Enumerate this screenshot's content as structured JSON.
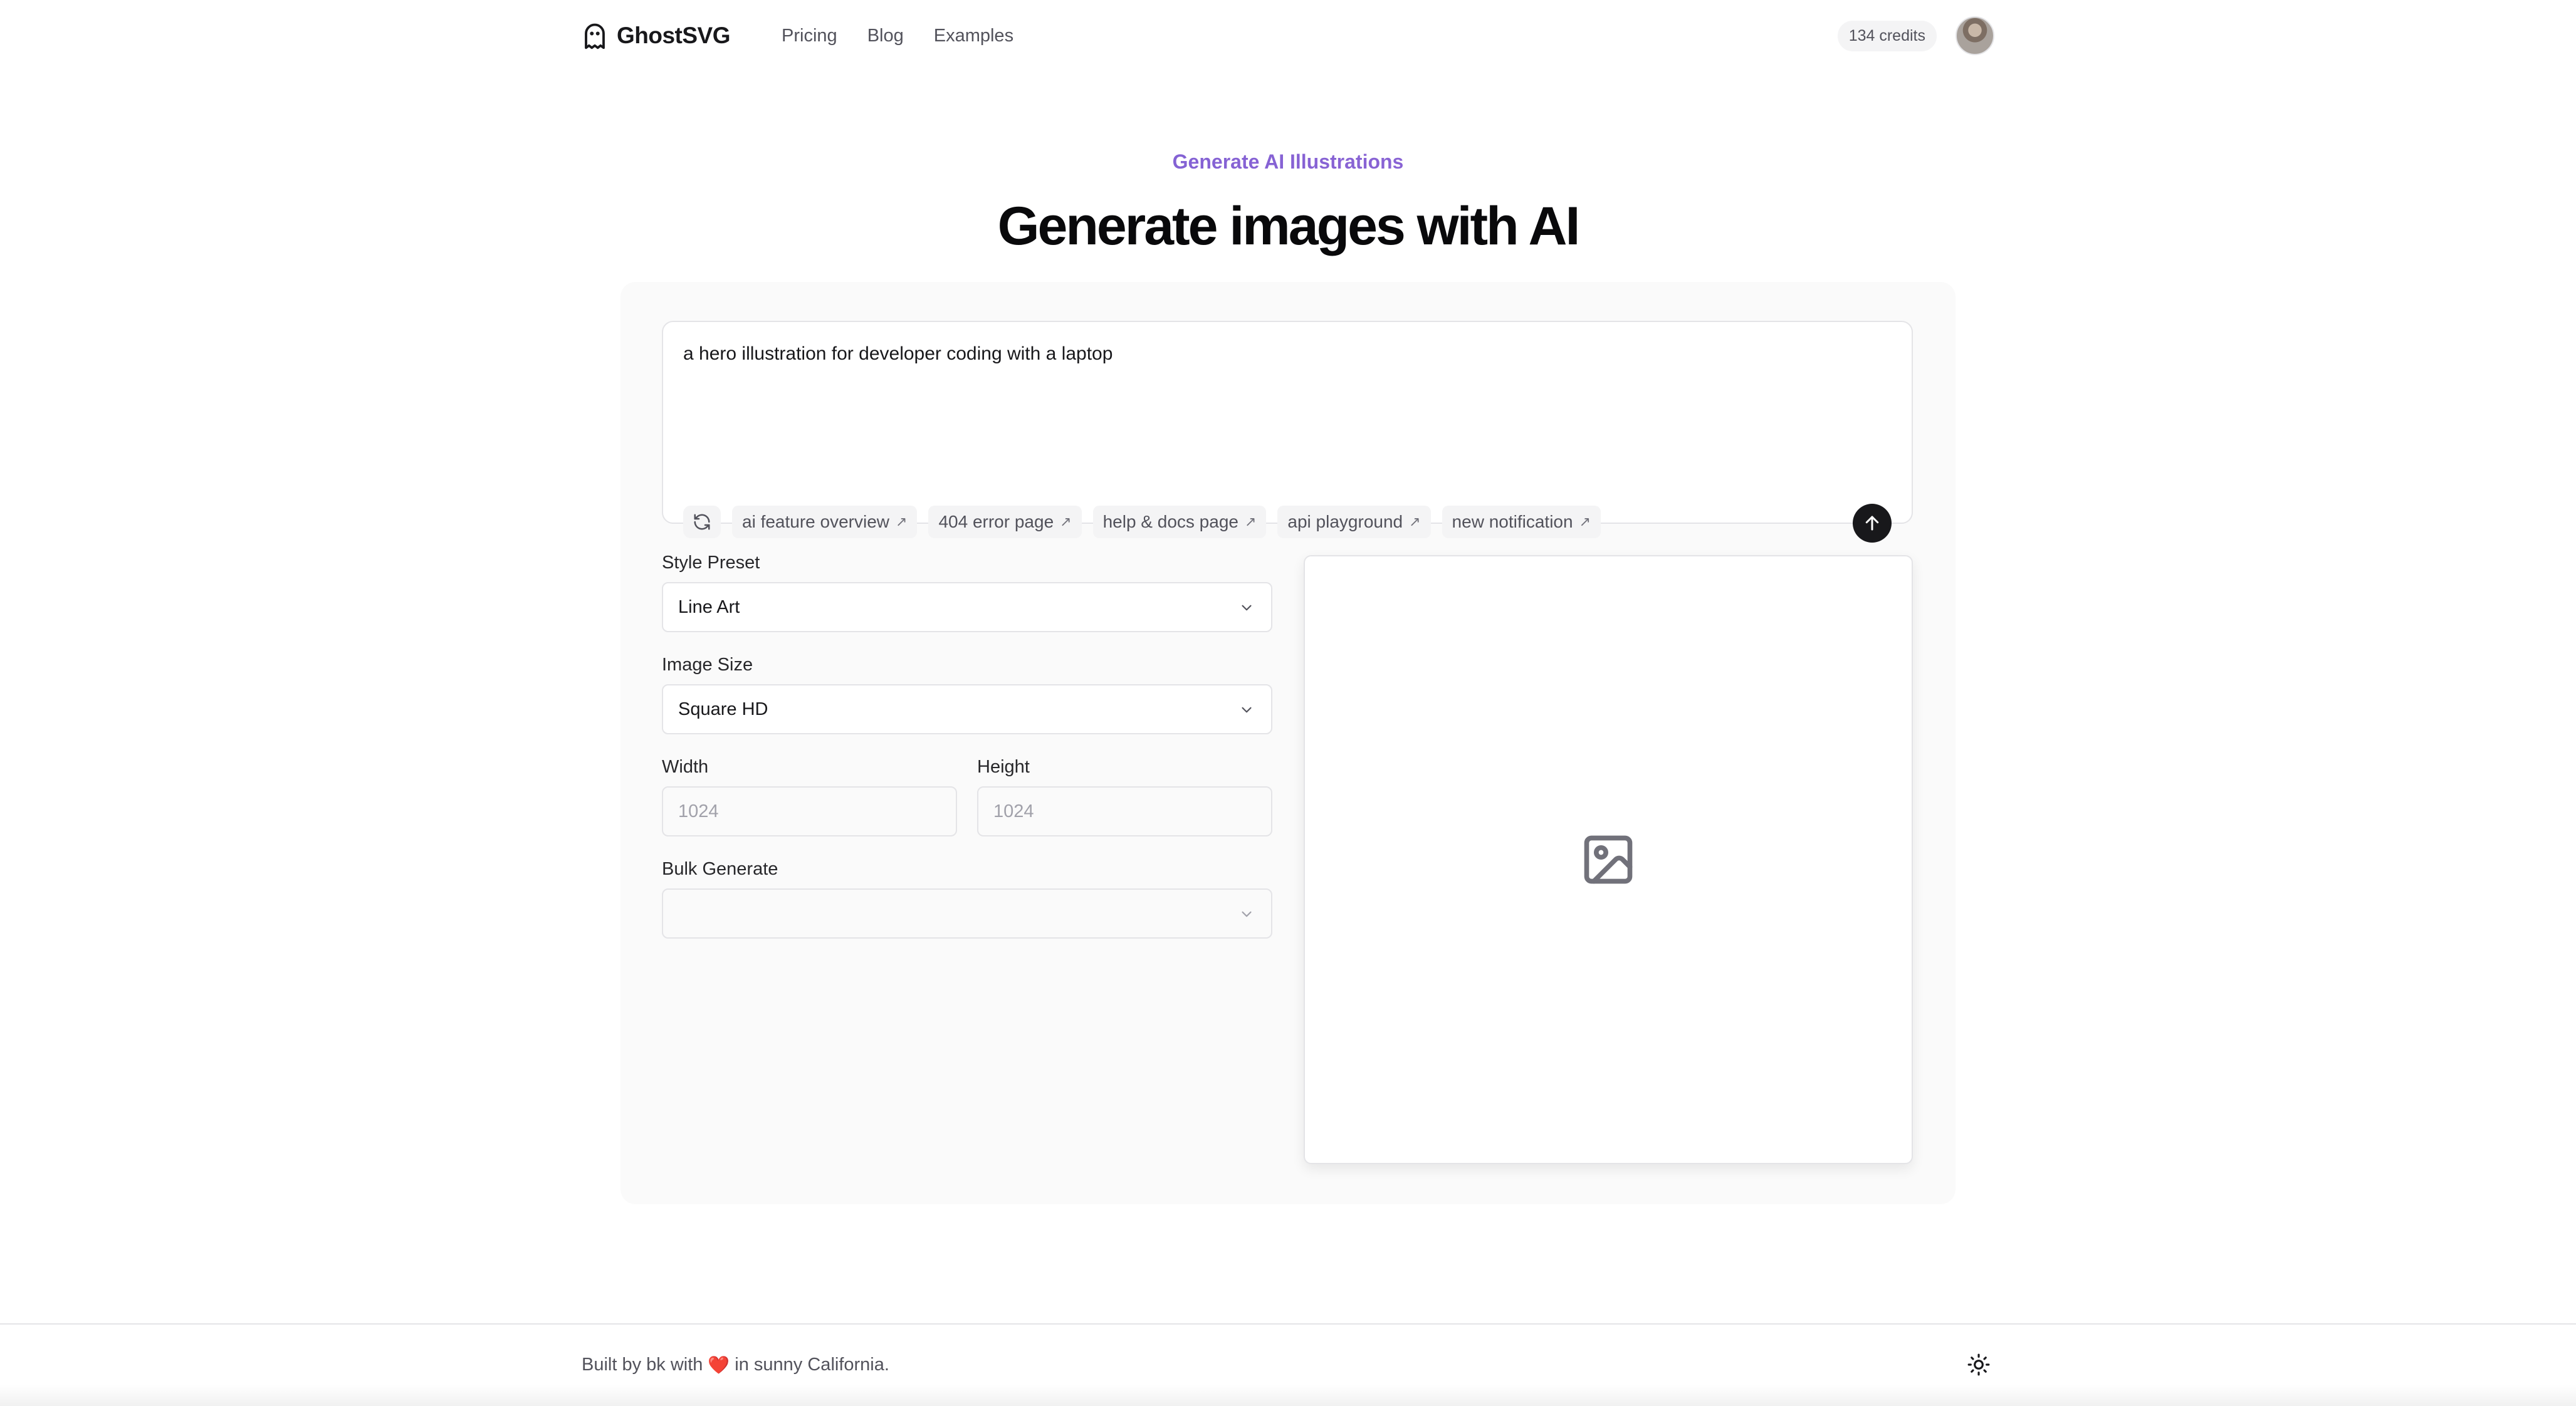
{
  "header": {
    "brand": "GhostSVG",
    "brand_icon": "ghost-icon",
    "nav": [
      "Pricing",
      "Blog",
      "Examples"
    ],
    "credits": "134 credits"
  },
  "hero": {
    "eyebrow": "Generate AI Illustrations",
    "title": "Generate images with AI"
  },
  "prompt": {
    "value": "a hero illustration for developer coding with a laptop",
    "suggestions": [
      "ai feature overview",
      "404 error page",
      "help & docs page",
      "api playground",
      "new notification"
    ]
  },
  "form": {
    "style_label": "Style Preset",
    "style_value": "Line Art",
    "size_label": "Image Size",
    "size_value": "Square HD",
    "width_label": "Width",
    "width_value": "1024",
    "height_label": "Height",
    "height_value": "1024",
    "bulk_label": "Bulk Generate",
    "bulk_value": ""
  },
  "preview": {
    "icon": "image-placeholder-icon"
  },
  "footer": {
    "text_before": "Built by bk with",
    "text_after": "in sunny California.",
    "heart": "❤️"
  },
  "colors": {
    "accent_gradient_start": "#6d5bd0",
    "accent_gradient_end": "#a06ad8",
    "panel_bg": "#fafafa",
    "submit_bg": "#18181b"
  }
}
